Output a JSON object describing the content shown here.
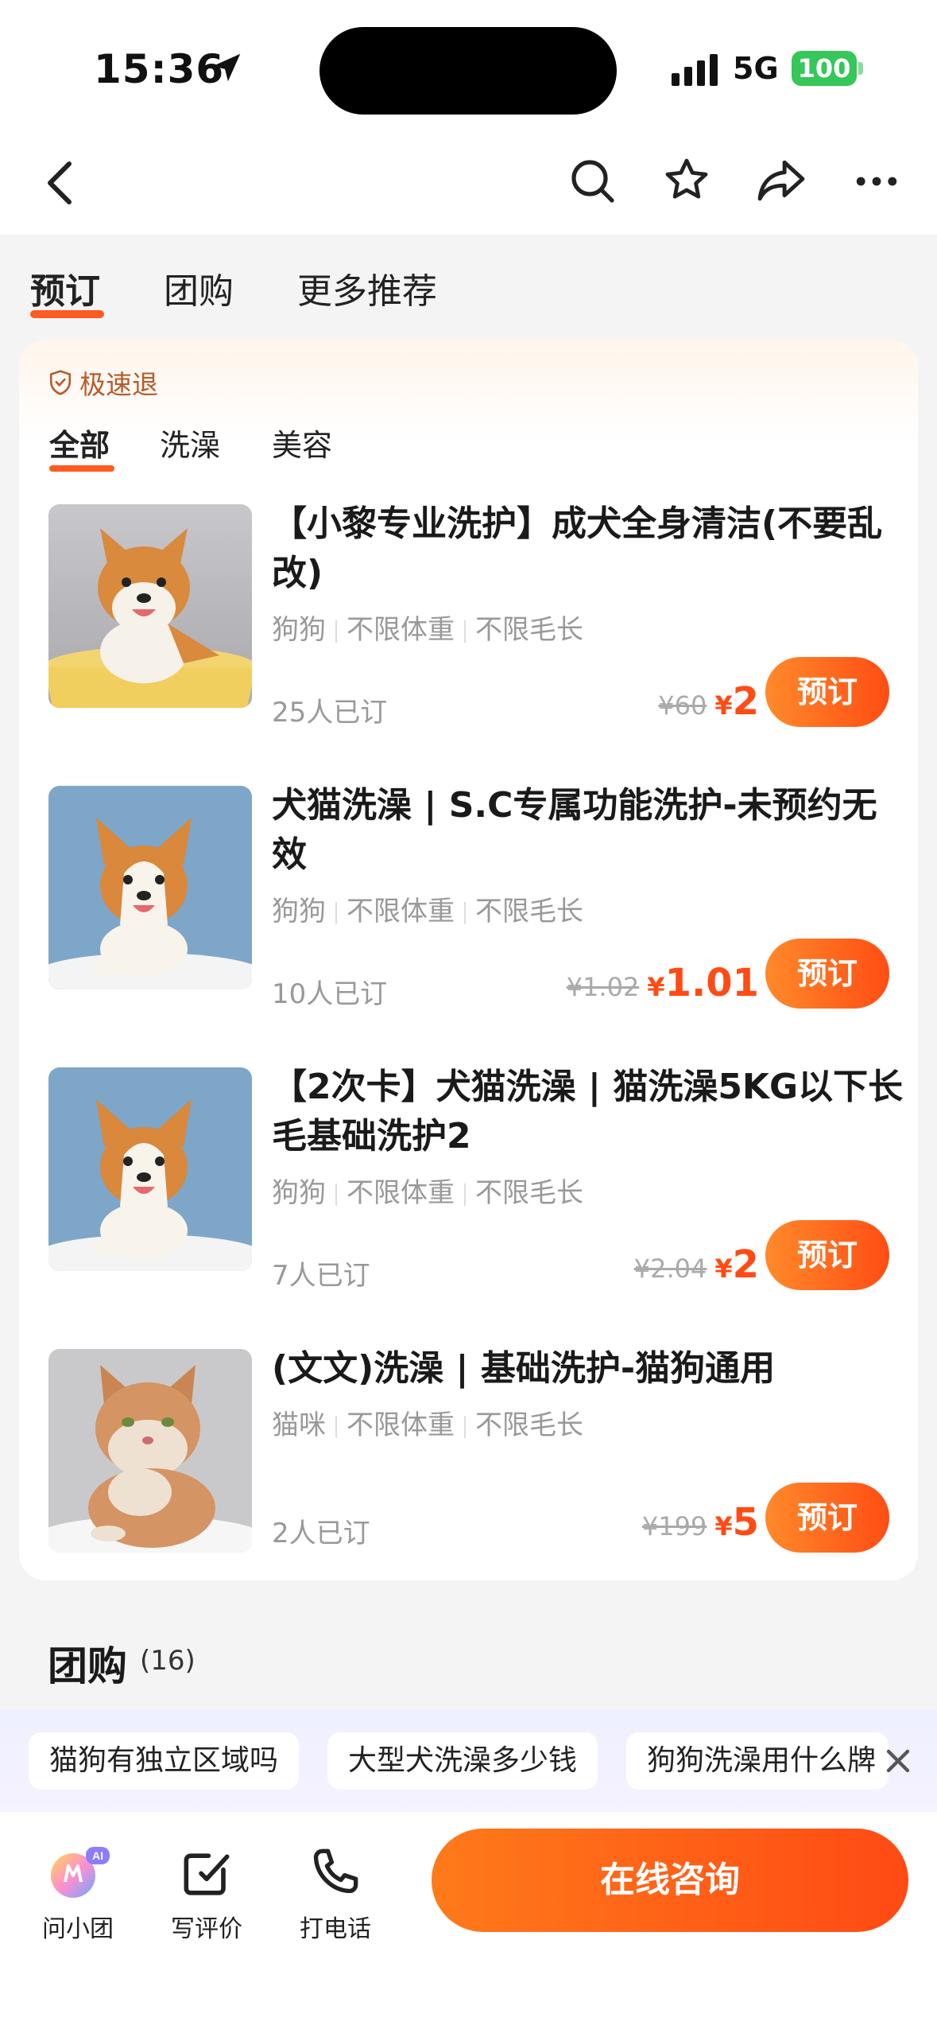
{
  "status_bar": {
    "time": "15:36",
    "network": "5G",
    "battery": "100"
  },
  "nav": {
    "back_icon": "back-icon",
    "search_icon": "search-icon",
    "star_icon": "star-icon",
    "share_icon": "share-icon",
    "more_icon": "more-icon"
  },
  "top_tabs": [
    {
      "label": "预订"
    },
    {
      "label": "团购"
    },
    {
      "label": "更多推荐"
    }
  ],
  "card": {
    "refund_badge": "极速退",
    "sub_tabs": [
      {
        "label": "全部"
      },
      {
        "label": "洗澡"
      },
      {
        "label": "美容"
      }
    ],
    "items": [
      {
        "title": "【小黎专业洗护】成犬全身清洁(不要乱改)",
        "tags": [
          "狗狗",
          "不限体重",
          "不限毛长"
        ],
        "sold": "25人已订",
        "old_price": "¥60",
        "currency": "¥",
        "price": "2",
        "button": "预订",
        "image": "shiba-dog-in-tub"
      },
      {
        "title": "犬猫洗澡 | S.C专属功能洗护-未预约无效",
        "tags": [
          "狗狗",
          "不限体重",
          "不限毛长"
        ],
        "sold": "10人已订",
        "old_price": "¥1.02",
        "currency": "¥",
        "price": "1.01",
        "button": "预订",
        "image": "corgi-in-tub"
      },
      {
        "title": "【2次卡】犬猫洗澡 | 猫洗澡5KG以下长毛基础洗护2",
        "tags": [
          "狗狗",
          "不限体重",
          "不限毛长"
        ],
        "sold": "7人已订",
        "old_price": "¥2.04",
        "currency": "¥",
        "price": "2",
        "button": "预订",
        "image": "corgi-in-tub"
      },
      {
        "title": "(文文)洗澡 | 基础洗护-猫狗通用",
        "tags": [
          "猫咪",
          "不限体重",
          "不限毛长"
        ],
        "sold": "2人已订",
        "old_price": "¥199",
        "currency": "¥",
        "price": "5",
        "button": "预订",
        "image": "fluffy-cat-in-tub"
      }
    ]
  },
  "group_section": {
    "title": "团购",
    "count": "(16)"
  },
  "chips": [
    {
      "label": "猫狗有独立区域吗"
    },
    {
      "label": "大型犬洗澡多少钱"
    },
    {
      "label": "狗狗洗澡用什么牌"
    }
  ],
  "bottom_bar": {
    "items": [
      {
        "label": "问小团",
        "icon": "ai-assistant-icon"
      },
      {
        "label": "写评价",
        "icon": "edit-review-icon"
      },
      {
        "label": "打电话",
        "icon": "phone-icon"
      }
    ],
    "consult_button": "在线咨询"
  },
  "colors": {
    "accent": "#ff5a1f",
    "price": "#ff4b14",
    "battery": "#35c759"
  }
}
